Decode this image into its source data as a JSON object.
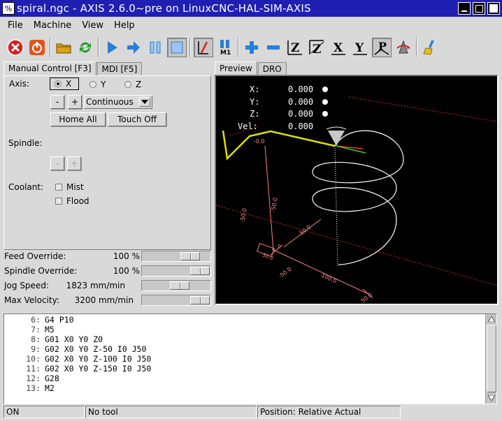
{
  "window": {
    "title": "spiral.ngc - AXIS 2.6.0~pre on LinuxCNC-HAL-SIM-AXIS",
    "app_icon_glyph": "%"
  },
  "menu": [
    {
      "label": "File"
    },
    {
      "label": "Machine"
    },
    {
      "label": "View"
    },
    {
      "label": "Help"
    }
  ],
  "toolbar": {
    "icons": [
      "estop-icon",
      "power-icon",
      "open-file-icon",
      "reload-icon",
      "run-icon",
      "step-icon",
      "pause-icon",
      "stop-icon",
      "block-delete-icon",
      "optional-stop-icon",
      "zoom-in-icon",
      "zoom-out-icon",
      "view-z-icon",
      "view-z2-icon",
      "view-x-icon",
      "view-y-icon",
      "view-p-icon",
      "rotate-icon",
      "clear-backplot-icon"
    ],
    "optional_stop_label": "M1",
    "view_letters": {
      "z": "Z",
      "z2": "Z",
      "x": "X",
      "y": "Y",
      "p": "P"
    }
  },
  "left_tabs": [
    {
      "label": "Manual Control [F3]",
      "active": true
    },
    {
      "label": "MDI [F5]",
      "active": false
    }
  ],
  "manual": {
    "axis_label": "Axis:",
    "axes": [
      {
        "label": "X",
        "selected": true
      },
      {
        "label": "Y",
        "selected": false
      },
      {
        "label": "Z",
        "selected": false
      }
    ],
    "jog_minus": "-",
    "jog_plus": "+",
    "jog_mode": "Continuous",
    "home_all": "Home All",
    "touch_off": "Touch Off",
    "spindle_label": "Spindle:",
    "spindle_minus": "-",
    "spindle_plus": "+",
    "coolant_label": "Coolant:",
    "mist": "Mist",
    "flood": "Flood"
  },
  "overrides": [
    {
      "name": "Feed Override:",
      "value": "100 %",
      "level": 0.8
    },
    {
      "name": "Spindle Override:",
      "value": "100 %",
      "level": 1.0
    },
    {
      "name": "Jog Speed:",
      "value": "1823 mm/min",
      "level": 0.57
    },
    {
      "name": "Max Velocity:",
      "value": "3200 mm/min",
      "level": 1.0
    }
  ],
  "right_tabs": [
    {
      "label": "Preview",
      "active": true
    },
    {
      "label": "DRO",
      "active": false
    }
  ],
  "preview": {
    "dro": [
      {
        "axis": "X:",
        "value": "0.000"
      },
      {
        "axis": "Y:",
        "value": "0.000"
      },
      {
        "axis": "Z:",
        "value": "0.000"
      },
      {
        "axis": "Vel:",
        "value": "0.000"
      }
    ],
    "dims": {
      "d1": "-0.0",
      "d2": "-50.0",
      "d3": "50.0",
      "d4": "50.0",
      "d5": "0",
      "d6": "-50.0",
      "d7": "100.0",
      "d8": "50.0",
      "d9": "-50.0"
    },
    "colors": {
      "background": "#000000",
      "path": "#ffffff",
      "rapid": "#ffffff",
      "limits": "#ff3030",
      "tool": "#c8c8c8",
      "dims": "#ff9090",
      "traverse": "#e0e000"
    }
  },
  "gcode": [
    {
      "line": "6:",
      "code": "G4 P10"
    },
    {
      "line": "7:",
      "code": "M5"
    },
    {
      "line": "8:",
      "code": "G01 X0 Y0 Z0"
    },
    {
      "line": "9:",
      "code": "G02 X0 Y0 Z-50 I0 J50"
    },
    {
      "line": "10:",
      "code": "G02 X0 Y0 Z-100 I0 J50"
    },
    {
      "line": "11:",
      "code": "G02 X0 Y0 Z-150 I0 J50"
    },
    {
      "line": "12:",
      "code": "G28"
    },
    {
      "line": "13:",
      "code": "M2"
    }
  ],
  "status": {
    "machine_state": "ON",
    "tool": "No tool",
    "position": "Position: Relative Actual"
  }
}
